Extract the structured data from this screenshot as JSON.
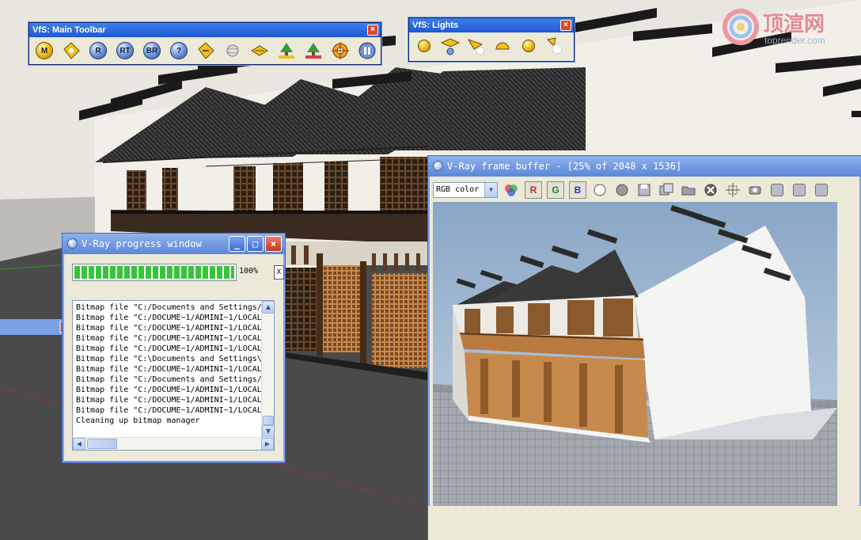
{
  "main_toolbar": {
    "title": "VfS: Main Toolbar",
    "close": "×",
    "buttons": [
      {
        "label": "M",
        "icon": "material-editor-icon"
      },
      {
        "label": "",
        "icon": "options-tag-icon"
      },
      {
        "label": "R",
        "icon": "render-icon"
      },
      {
        "label": "RT",
        "icon": "rt-render-icon"
      },
      {
        "label": "BR",
        "icon": "batch-render-icon"
      },
      {
        "label": "?",
        "icon": "help-icon"
      },
      {
        "label": "",
        "icon": "license-tag-icon"
      },
      {
        "label": "",
        "icon": "sphere-icon"
      },
      {
        "label": "",
        "icon": "infinite-plane-icon"
      },
      {
        "label": "",
        "icon": "export-proxy-icon"
      },
      {
        "label": "",
        "icon": "import-proxy-icon"
      },
      {
        "label": "",
        "icon": "camera-focus-icon"
      },
      {
        "label": "",
        "icon": "pause-icon"
      }
    ]
  },
  "lights_toolbar": {
    "title": "VfS: Lights",
    "close": "×",
    "buttons": [
      {
        "icon": "omni-light-icon"
      },
      {
        "icon": "rectangle-light-icon"
      },
      {
        "icon": "spot-light-icon"
      },
      {
        "icon": "dome-light-icon"
      },
      {
        "icon": "sphere-light-icon"
      },
      {
        "icon": "ies-light-icon"
      }
    ]
  },
  "watermark": {
    "title": "顶渲网",
    "url": "toprender.com"
  },
  "progress_window": {
    "title": "V-Ray progress window",
    "percent_label": "100%",
    "cancel_label": "X",
    "progress_value": 1.0,
    "log_lines": [
      "Bitmap file \"C:/Documents and Settings/",
      "Bitmap file \"C:/DOCUME~1/ADMINI~1/LOCAL",
      "Bitmap file \"C:/DOCUME~1/ADMINI~1/LOCAL",
      "Bitmap file \"C:/DOCUME~1/ADMINI~1/LOCAL",
      "Bitmap file \"C:/DOCUME~1/ADMINI~1/LOCAL",
      "Bitmap file \"C:\\Documents and Settings\\",
      "Bitmap file \"C:/DOCUME~1/ADMINI~1/LOCAL",
      "Bitmap file \"C:/Documents and Settings/",
      "Bitmap file \"C:/DOCUME~1/ADMINI~1/LOCAL",
      "Bitmap file \"C:/DOCUME~1/ADMINI~1/LOCAL",
      "Bitmap file \"C:/DOCUME~1/ADMINI~1/LOCAL",
      "Cleaning up bitmap manager"
    ]
  },
  "frame_buffer": {
    "title": "V-Ray frame buffer - [25% of 2048 x 1536]",
    "channel_select": "RGB color",
    "channel_buttons": [
      "R",
      "G",
      "B"
    ],
    "tool_icons": [
      "color-channels-icon",
      "white-circle-icon",
      "grey-circle-icon",
      "save-image-icon",
      "duplicate-icon",
      "open-folder-icon",
      "clear-icon",
      "track-mouse-icon",
      "lens-effects-icon",
      "compare-icon",
      "display-correction-icon",
      "history-icon"
    ]
  },
  "colors": {
    "xp_title": "#5c86d8",
    "toolbar_title": "#1d5ad6",
    "progress_green": "#37c437",
    "window_face": "#ece9d8"
  }
}
